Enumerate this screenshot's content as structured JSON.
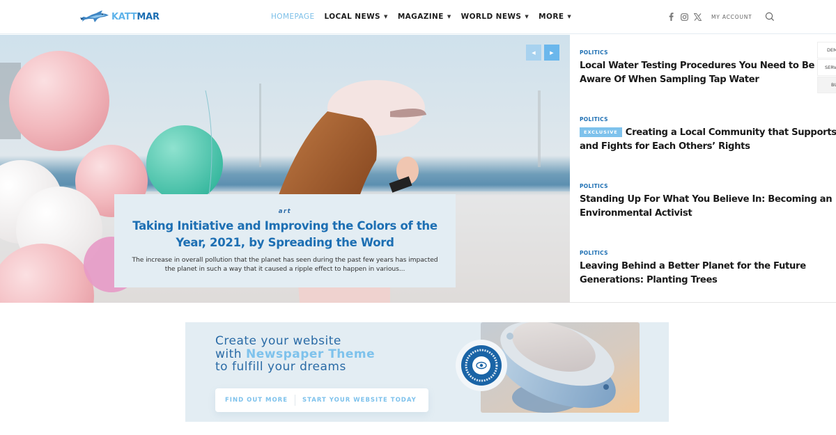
{
  "header": {
    "logo": {
      "part1": "KATT",
      "part2": "MAR"
    },
    "nav": [
      {
        "label": "HOMEPAGE",
        "active": true,
        "has_dropdown": false
      },
      {
        "label": "LOCAL NEWS",
        "active": false,
        "has_dropdown": true
      },
      {
        "label": "MAGAZINE",
        "active": false,
        "has_dropdown": true
      },
      {
        "label": "WORLD NEWS",
        "active": false,
        "has_dropdown": true
      },
      {
        "label": "MORE",
        "active": false,
        "has_dropdown": true
      }
    ],
    "social_icons": [
      "facebook-icon",
      "instagram-icon",
      "x-twitter-icon"
    ],
    "account_label": "MY ACCOUNT",
    "search_icon": "search-icon"
  },
  "hero": {
    "category": "art",
    "title": "Taking Initiative and Improving the Colors of the Year, 2021, by Spreading the Word",
    "excerpt": "The increase in overall pollution that the planet has seen during the past few years has impacted the planet in such a way that it caused a ripple effect to happen in various...",
    "prev_icon": "chevron-left-icon",
    "next_icon": "chevron-right-icon"
  },
  "side_list": [
    {
      "category": "POLITICS",
      "badge": null,
      "title": "Local Water Testing Procedures You Need to Be Aware Of When Sampling Tap Water"
    },
    {
      "category": "POLITICS",
      "badge": "EXCLUSIVE",
      "title": "Creating a Local Community that Supports and Fights for Each Others’ Rights"
    },
    {
      "category": "POLITICS",
      "badge": null,
      "title": "Standing Up For What You Believe In: Becoming an Environmental Activist"
    },
    {
      "category": "POLITICS",
      "badge": null,
      "title": "Leaving Behind a Better Planet for the Future Generations: Planting Trees"
    }
  ],
  "demo_tabs": [
    "DEM",
    "SERV",
    "BU"
  ],
  "banner": {
    "line1": "Create your website",
    "line2_prefix": "with ",
    "line2_highlight": "Newspaper Theme",
    "line3": "to fulfill your dreams",
    "button1": "FIND OUT MORE",
    "button2": "START YOUR WEBSITE TODAY",
    "seal_text": "explore a myriad of different ideas"
  },
  "colors": {
    "accent_light": "#7ec2ec",
    "accent_dark": "#1d6fb3",
    "panel_bg": "#e3edf3"
  }
}
